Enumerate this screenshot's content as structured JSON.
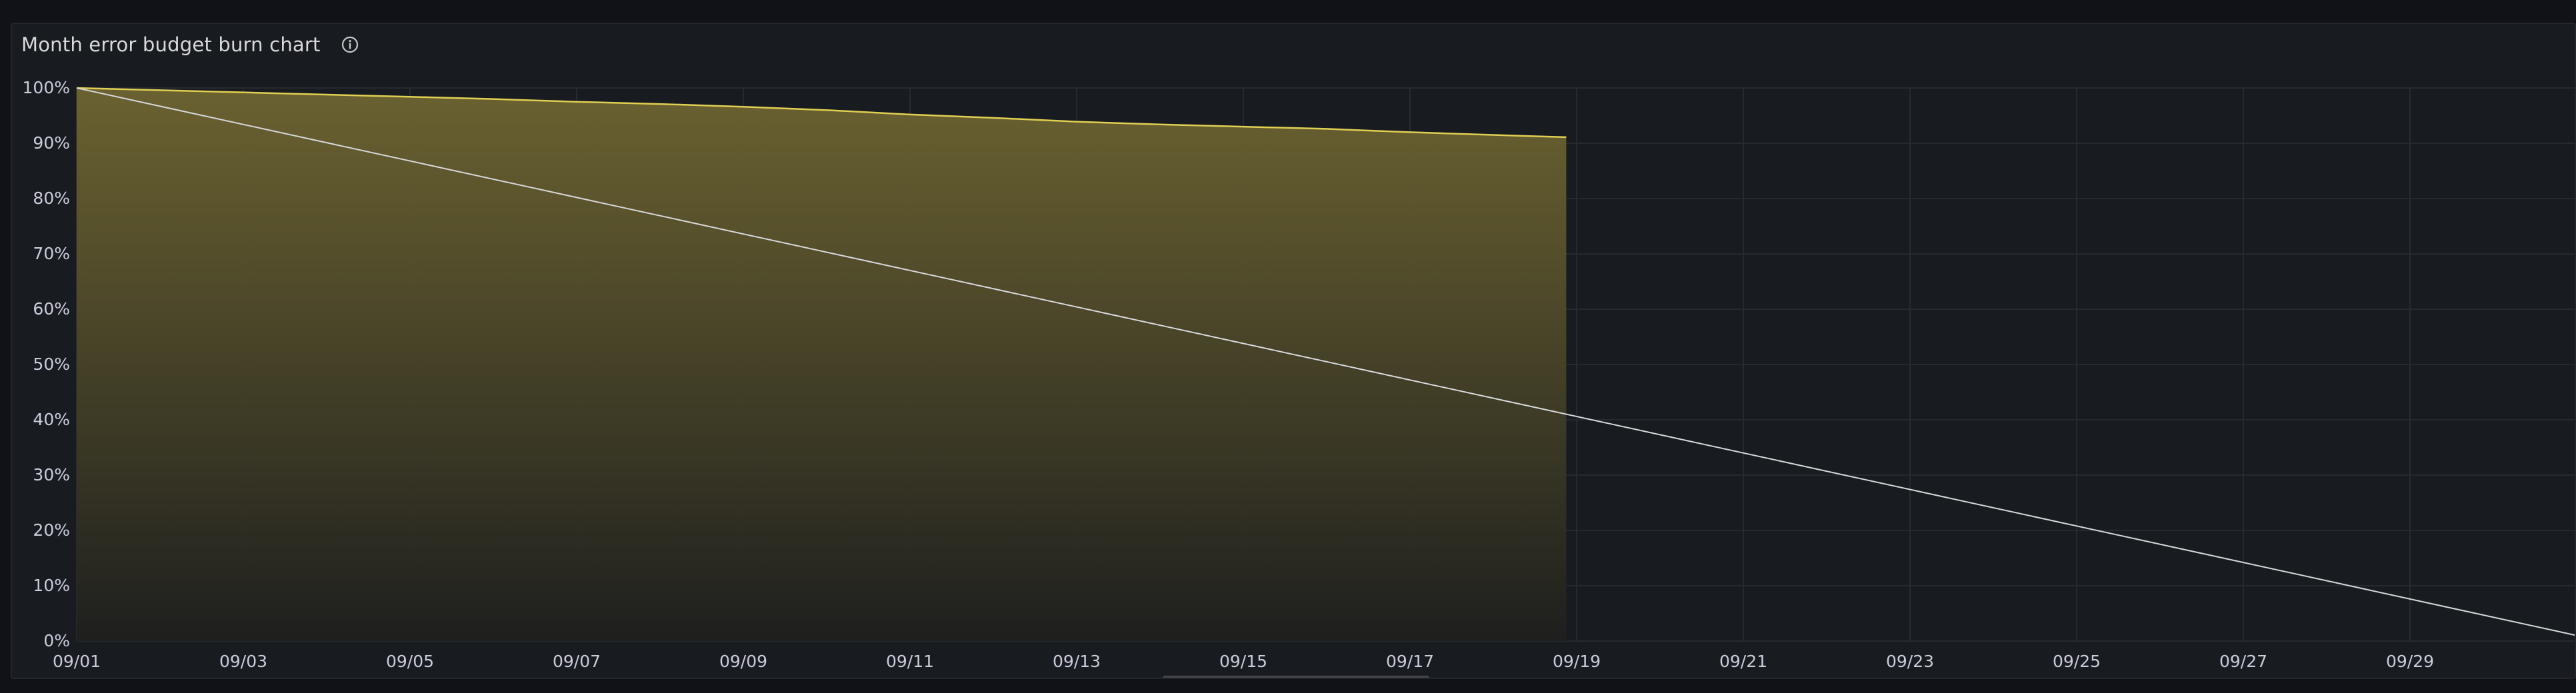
{
  "panel": {
    "title": "Month error budget burn chart",
    "info_icon": "info-circle-icon"
  },
  "colors": {
    "background": "#111217",
    "panel_bg": "#181b1f",
    "grid": "#26292f",
    "axis_text": "#ccccdc",
    "budget_line": "#e0cf52",
    "budget_fill_top": "#6e6531",
    "budget_fill_bottom": "#1e1f1e",
    "ideal_line": "#d6d7da"
  },
  "chart_data": {
    "type": "area",
    "x_start": "09/01",
    "x_end": "10/01",
    "ylim": [
      0,
      100
    ],
    "y_ticks": [
      "0%",
      "10%",
      "20%",
      "30%",
      "40%",
      "50%",
      "60%",
      "70%",
      "80%",
      "90%",
      "100%"
    ],
    "x_ticks": [
      "09/01",
      "09/03",
      "09/05",
      "09/07",
      "09/09",
      "09/11",
      "09/13",
      "09/15",
      "09/17",
      "09/19",
      "09/21",
      "09/23",
      "09/25",
      "09/27",
      "09/29"
    ],
    "series": [
      {
        "style": "area",
        "x": [
          "09/01",
          "09/02",
          "09/03",
          "09/04",
          "09/05",
          "09/06",
          "09/07",
          "09/08",
          "09/09",
          "09/10",
          "09/11",
          "09/12",
          "09/13",
          "09/14",
          "09/15",
          "09/16",
          "09/17",
          "09/18",
          "09/18 21:00"
        ],
        "values": [
          100,
          99.6,
          99.2,
          98.8,
          98.4,
          98.0,
          97.5,
          97.1,
          96.6,
          96.0,
          95.2,
          94.6,
          93.9,
          93.4,
          93.0,
          92.6,
          92.0,
          91.5,
          91.1
        ]
      },
      {
        "style": "line",
        "x": [
          "09/01",
          "10/01"
        ],
        "values": [
          100,
          1
        ]
      }
    ]
  }
}
